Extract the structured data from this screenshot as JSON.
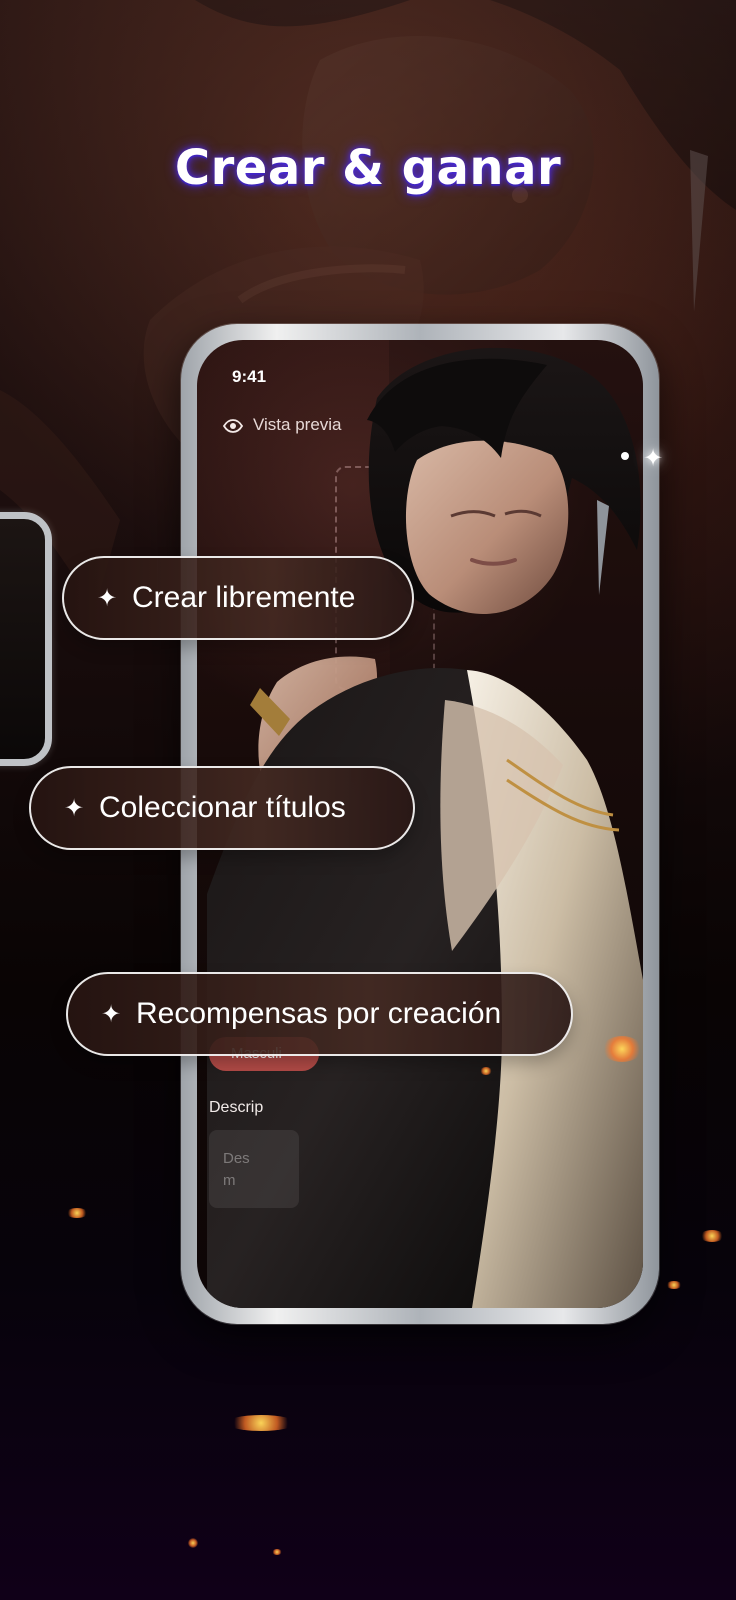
{
  "headline": "Crear & ganar",
  "phone": {
    "status_time": "9:41",
    "preview_label": "Vista previa",
    "gender_chip": "Masculi",
    "description_label": "Descrip",
    "description_placeholder_line1": "Des",
    "description_placeholder_line2": "m"
  },
  "features": [
    {
      "icon": "sparkle-icon",
      "label": "Crear libremente"
    },
    {
      "icon": "sparkle-icon",
      "label": "Coleccionar títulos"
    },
    {
      "icon": "sparkle-icon",
      "label": "Recompensas por creación"
    }
  ],
  "colors": {
    "headline_glow": "#4b2bd7",
    "chip": "#b34b47",
    "pill_border": "#ffffff"
  }
}
